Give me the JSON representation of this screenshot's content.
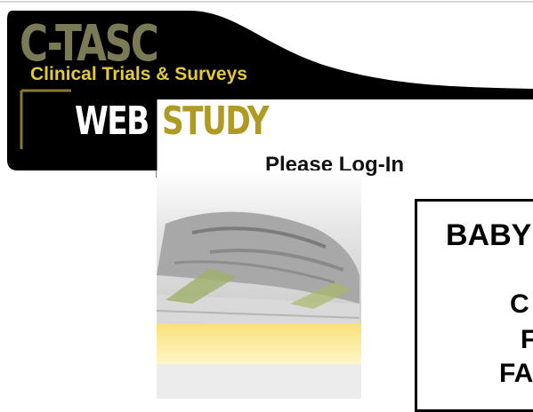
{
  "logo": {
    "brand": "C-TASC",
    "tagline": "Clinical Trials & Surveys",
    "product_word1": "WEB",
    "product_word2": "STUDY"
  },
  "login": {
    "heading": "Please Log-In"
  },
  "study_box": {
    "line1": "BABY",
    "line2": "C",
    "line3": "F",
    "line4": "FA"
  },
  "colors": {
    "banner_bg": "#000000",
    "brand_olive": "#7a7a55",
    "tagline_yellow": "#e3c83a",
    "study_gold": "#b09a22"
  }
}
